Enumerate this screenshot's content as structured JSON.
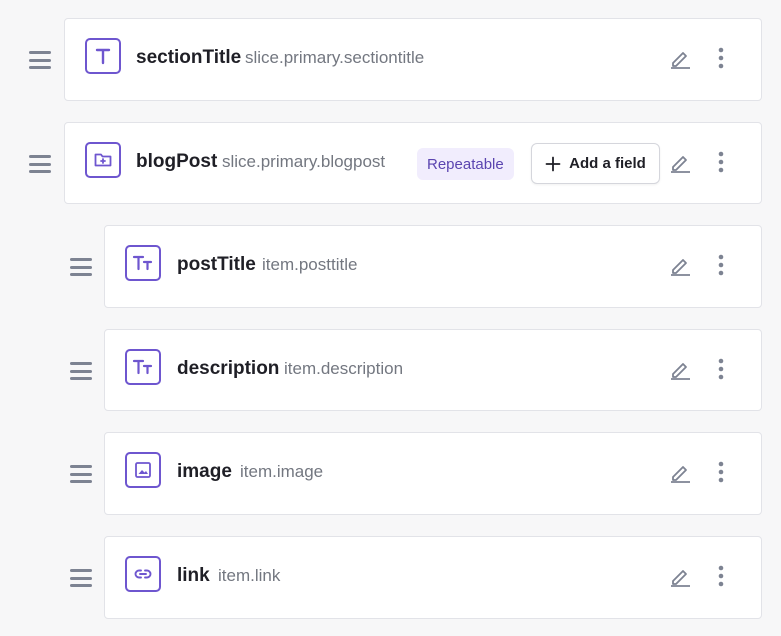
{
  "fields": [
    {
      "name": "sectionTitle",
      "path": "slice.primary.sectiontitle",
      "icon": "text-t-icon"
    },
    {
      "name": "blogPost",
      "path": "slice.primary.blogpost",
      "icon": "group-folder-icon",
      "badge": "Repeatable",
      "add_label": "Add a field"
    },
    {
      "name": "postTitle",
      "path": "item.posttitle",
      "icon": "title-text-icon"
    },
    {
      "name": "description",
      "path": "item.description",
      "icon": "rich-text-icon"
    },
    {
      "name": "image",
      "path": "item.image",
      "icon": "image-icon"
    },
    {
      "name": "link",
      "path": "item.link",
      "icon": "link-icon"
    }
  ],
  "colors": {
    "accent": "#6e56cf",
    "badge_bg": "#f1edfd",
    "icon_gray": "#7d8392"
  }
}
